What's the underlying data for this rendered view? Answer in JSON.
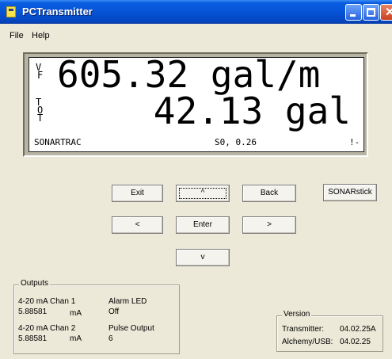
{
  "window": {
    "title": "PCTransmitter"
  },
  "menu": {
    "file": "File",
    "help": "Help"
  },
  "display": {
    "line1_unit_top": "V",
    "line1_unit_bottom": "F",
    "line1_value": "605.32 gal/m",
    "line2_unit_t1": "T",
    "line2_unit_o": "O",
    "line2_unit_t2": "T",
    "line2_value": "42.13 gal",
    "status_left": "SONARTRAC",
    "status_mid": "S0, 0.26",
    "status_right": "!-"
  },
  "buttons": {
    "exit": "Exit",
    "up": "^",
    "back": "Back",
    "sonarstick": "SONARstick",
    "left": "<",
    "enter": "Enter",
    "right": ">",
    "down": "v"
  },
  "outputs": {
    "legend": "Outputs",
    "chan1_label": "4-20 mA Chan 1",
    "chan1_value": "5.88581",
    "chan1_unit": "mA",
    "alarm_label": "Alarm LED",
    "alarm_value": "Off",
    "chan2_label": "4-20 mA Chan 2",
    "chan2_value": "5.88581",
    "chan2_unit": "mA",
    "pulse_label": "Pulse Output",
    "pulse_value": "6"
  },
  "version": {
    "legend": "Version",
    "transmitter_label": "Transmitter:",
    "transmitter_value": "04.02.25A",
    "alchemy_label": "Alchemy/USB:",
    "alchemy_value": "04.02.25"
  }
}
